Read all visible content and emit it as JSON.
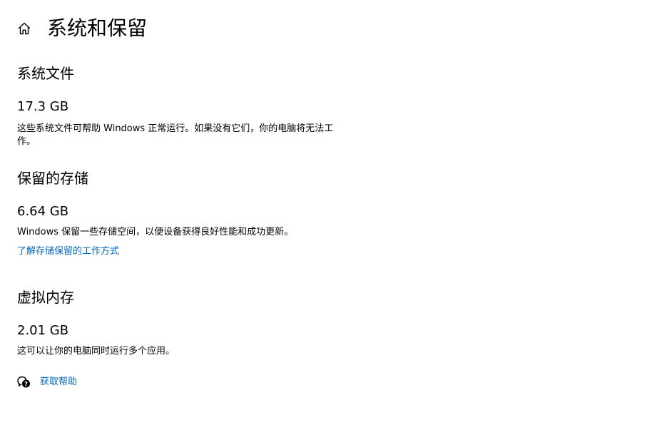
{
  "header": {
    "title": "系统和保留",
    "home_icon": "home-icon"
  },
  "system_files": {
    "title": "系统文件",
    "size": "17.3 GB",
    "description": "这些系统文件可帮助 Windows 正常运行。如果没有它们，你的电脑将无法工作。"
  },
  "reserved_storage": {
    "title": "保留的存储",
    "size": "6.64 GB",
    "description": "Windows 保留一些存储空间，以便设备获得良好性能和成功更新。",
    "learn_more_link": "了解存储保留的工作方式"
  },
  "virtual_memory": {
    "title": "虚拟内存",
    "size": "2.01 GB",
    "description": "这可以让你的电脑同时运行多个应用。"
  },
  "help": {
    "label": "获取帮助",
    "icon": "help-chat-icon"
  },
  "colors": {
    "link": "#0067b8",
    "text": "#000000",
    "background": "#ffffff"
  }
}
